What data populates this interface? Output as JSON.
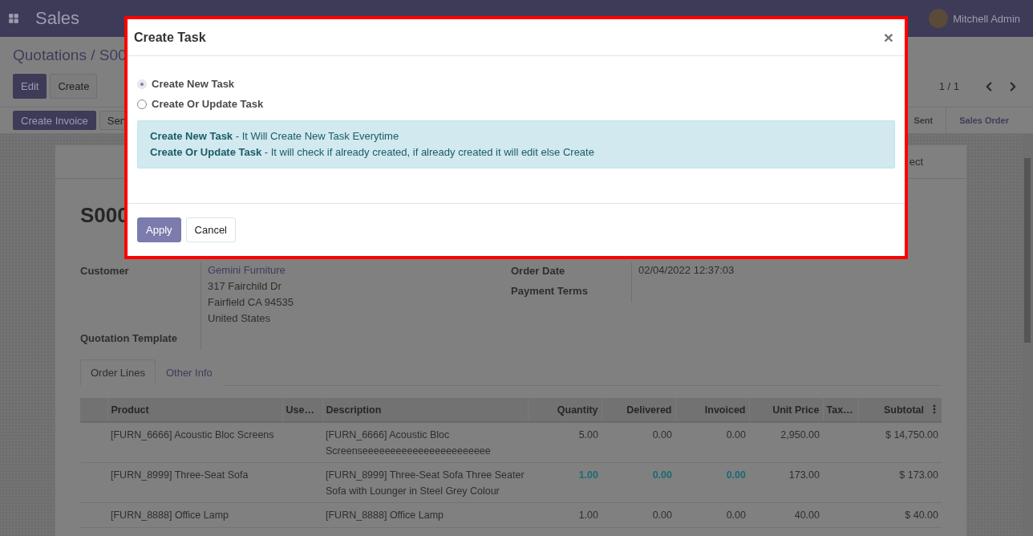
{
  "app_bar": {
    "app_name": "Sales",
    "user": {
      "name": "Mitchell Admin"
    }
  },
  "breadcrumb": "Quotations / S00",
  "control_buttons": [
    {
      "label": "Edit",
      "primary": true
    },
    {
      "label": "Create",
      "primary": false
    }
  ],
  "pager": "1 / 1",
  "action_buttons": [
    {
      "label": "Create Invoice",
      "primary": true
    },
    {
      "label": "Sen",
      "primary": false
    }
  ],
  "status_steps": [
    {
      "label": "Sent",
      "selected": false
    },
    {
      "label": "Sales Order",
      "selected": true
    }
  ],
  "button_box": [
    "ect"
  ],
  "record_title": "S000",
  "fields_left": [
    {
      "label": "Customer",
      "lines": [
        "Gemini Furniture",
        "317 Fairchild Dr",
        "Fairfield CA 94535",
        "United States"
      ]
    },
    {
      "label": "Quotation Template"
    }
  ],
  "fields_right": [
    {
      "label": "Order Date",
      "lines": [
        "02/04/2022 12:37:03"
      ]
    },
    {
      "label": "Payment Terms"
    }
  ],
  "tabs": [
    {
      "label": "Order Lines",
      "selected": true
    },
    {
      "label": "Other Info",
      "selected": false
    }
  ],
  "table": {
    "columns": [
      "Product",
      "Use…",
      "Description",
      "Quantity",
      "Delivered",
      "Invoiced",
      "Unit Price",
      "Tax…",
      "Subtotal"
    ],
    "rows": [
      {
        "highlighted": false,
        "cells": [
          "[FURN_6666] Acoustic Bloc Screens",
          "",
          "[FURN_6666] Acoustic Bloc Screenseeeeeeeeeeeeeeeeeeeeeee",
          "5.00",
          "0.00",
          "0.00",
          "2,950.00",
          "",
          "$ 14,750.00"
        ]
      },
      {
        "highlighted": true,
        "cells": [
          "[FURN_8999] Three-Seat Sofa",
          "",
          "[FURN_8999] Three-Seat Sofa Three Seater Sofa with Lounger in Steel Grey Colour",
          "1.00",
          "0.00",
          "0.00",
          "173.00",
          "",
          "$ 173.00"
        ]
      },
      {
        "highlighted": false,
        "cells": [
          "[FURN_8888] Office Lamp",
          "",
          "[FURN_8888] Office Lamp",
          "1.00",
          "0.00",
          "0.00",
          "40.00",
          "",
          "$ 40.00"
        ]
      }
    ]
  },
  "dialog": {
    "title": "Create Task",
    "close": "×",
    "options": [
      {
        "label": "Create New Task",
        "selected": true
      },
      {
        "label": "Create Or Update Task",
        "selected": false
      }
    ],
    "info_lines": [
      "**Create New Task** - It Will Create New Task Everytime",
      "**Create Or Update Task** - It will check if already created, if already created it will edit else Create"
    ],
    "buttons": [
      {
        "label": "Apply",
        "primary": true
      },
      {
        "label": "Cancel",
        "primary": false
      }
    ]
  }
}
